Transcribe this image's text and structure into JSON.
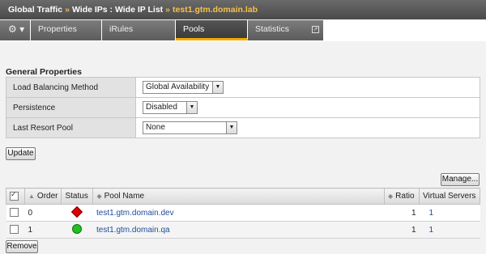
{
  "breadcrumb": {
    "part1": "Global Traffic",
    "part2": "Wide IPs : Wide IP List",
    "current": "test1.gtm.domain.lab",
    "sep": "»"
  },
  "tabs": {
    "gear_menu": "⚙ ▾",
    "properties": "Properties",
    "irules": "iRules",
    "pools": "Pools",
    "statistics": "Statistics",
    "ext_icon": "↗"
  },
  "general": {
    "title": "General Properties",
    "lb_method_label": "Load Balancing Method",
    "lb_method_value": "Global Availability",
    "persistence_label": "Persistence",
    "persistence_value": "Disabled",
    "last_resort_label": "Last Resort Pool",
    "last_resort_value": "None",
    "update_button": "Update"
  },
  "pools": {
    "manage_button": "Manage...",
    "columns": {
      "order": "Order",
      "status": "Status",
      "pool_name": "Pool Name",
      "ratio": "Ratio",
      "virtual_servers": "Virtual Servers"
    },
    "rows": [
      {
        "order": "0",
        "status": "red-diamond",
        "pool_name": "test1.gtm.domain.dev",
        "ratio": "1",
        "virtual_servers": "1"
      },
      {
        "order": "1",
        "status": "green-circle",
        "pool_name": "test1.gtm.domain.qa",
        "ratio": "1",
        "virtual_servers": "1"
      }
    ],
    "remove_button": "Remove"
  },
  "colors": {
    "accent": "#f2a900",
    "link": "#1f4c9a",
    "status_down": "#e00000",
    "status_up": "#22c022"
  }
}
